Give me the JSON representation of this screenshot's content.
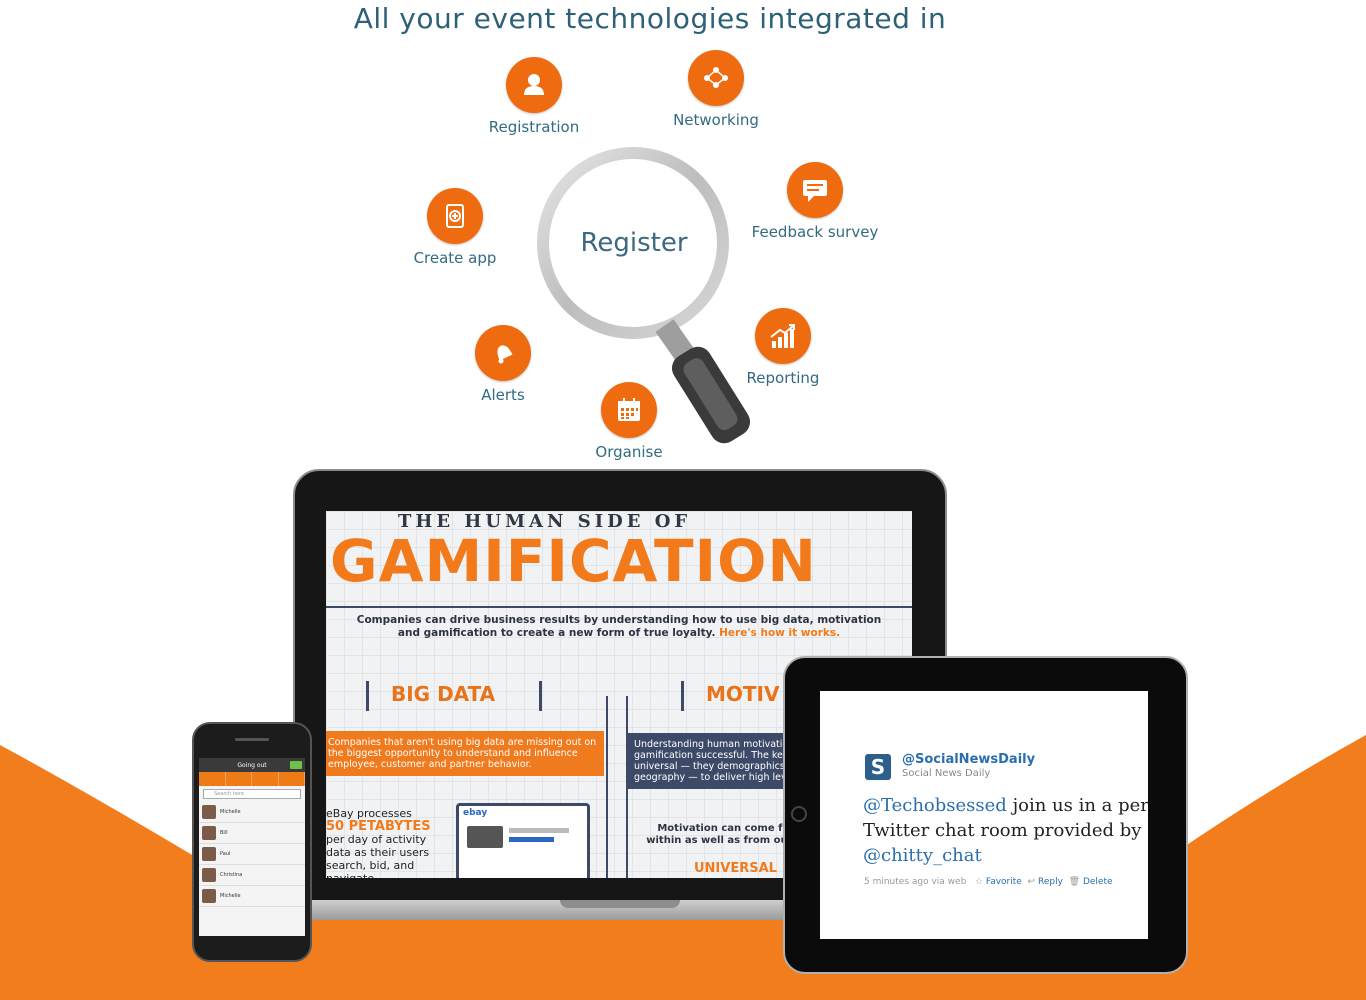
{
  "headline": "All your event technologies integrated in",
  "center_label": "Register",
  "features": [
    {
      "label": "Registration",
      "icon": "user-icon"
    },
    {
      "label": "Networking",
      "icon": "network-icon"
    },
    {
      "label": "Feedback survey",
      "icon": "chat-bubble-icon"
    },
    {
      "label": "Create app",
      "icon": "app-add-icon"
    },
    {
      "label": "Reporting",
      "icon": "growth-chart-icon"
    },
    {
      "label": "Alerts",
      "icon": "bell-icon"
    },
    {
      "label": "Organise",
      "icon": "calendar-icon"
    }
  ],
  "laptop_screen": {
    "title_small": "THE HUMAN SIDE OF",
    "title_big": "GAMIFICATION",
    "lead": "Companies can drive business results by understanding how to use big data, motivation and gamification to create a new form of true loyalty.",
    "lead_link": "Here's how it works.",
    "big_data_title": "BIG DATA",
    "big_data_text": "Companies that aren't using big data are missing out on the biggest opportunity to understand and influence employee, customer and partner behavior.",
    "motiv_title": "MOTIV",
    "motiv_text": "Understanding human motivation is the key to making gamification successful. The key motivators are universal — they demographics, psychographics, and geography — to deliver high levels of engagement.",
    "ebay_line1": "eBay processes",
    "ebay_big": "50 PETABYTES",
    "ebay_line2": "per day of activity data as their users search, bid, and navigate",
    "ebay_logo": "ebay",
    "motivation_text": "Motivation can come from within as well as from outside",
    "universal": "UNIVERSAL"
  },
  "tablet_screen": {
    "handle": "@SocialNewsDaily",
    "name": "Social News Daily",
    "avatar_letter": "S",
    "mention1": "@Techobsessed",
    "body1": " join us in a personal",
    "body2": "Twitter chat room provided by",
    "mention2": "@chitty_chat",
    "time": "5 minutes ago via web",
    "favorite": "Favorite",
    "reply": "Reply",
    "delete": "Delete"
  },
  "phone_screen": {
    "title": "Going out",
    "search_placeholder": "Search here",
    "rows": [
      "Michelle",
      "Bill",
      "Paul",
      "Christina",
      "Michelle"
    ]
  },
  "colors": {
    "accent": "#ef6b10",
    "headline": "#2e6177",
    "wave": "#f17d1c"
  }
}
